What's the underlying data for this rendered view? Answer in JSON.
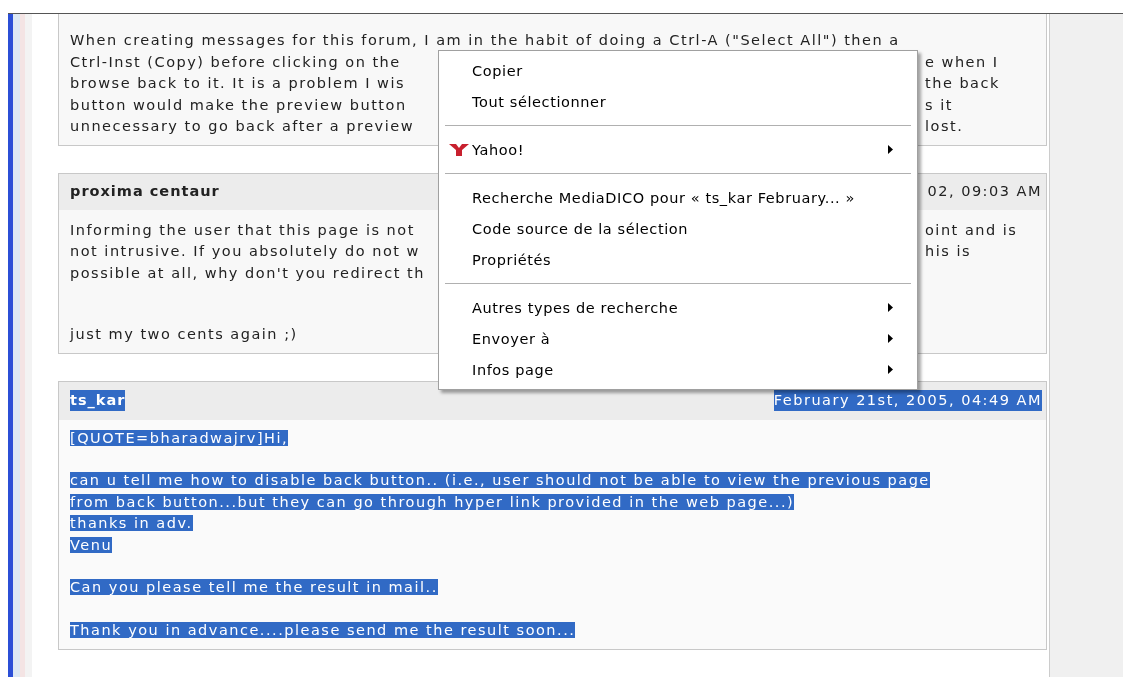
{
  "posts": [
    {
      "lines": [
        {
          "left": "When creating messages for this forum, I am in the habit of doing a Ctrl-A (\"Select All\") then a"
        },
        {
          "left": "Ctrl-Inst (Copy) before clicking on the",
          "right": "e when I"
        },
        {
          "left": "browse back to it. It is a problem I wis",
          "right": "the back"
        },
        {
          "left": "button would make the preview button",
          "right": "s it"
        },
        {
          "left": "unnecessary to go back after a preview",
          "right": "lost."
        }
      ]
    },
    {
      "author": "proxima centaur",
      "date": "02, 09:03 AM",
      "lines": [
        {
          "left": "Informing the user that this page is not",
          "right": "oint and is"
        },
        {
          "left": "not intrusive. If you absolutely do not w",
          "right": "his is"
        },
        {
          "left": "possible at all, why don't you redirect th"
        }
      ],
      "tail": "just my two cents again ;)"
    }
  ],
  "selected_post": {
    "author": "ts_kar",
    "date": "February 21st, 2005, 04:49 AM",
    "selected": true,
    "paragraphs": [
      [
        "[QUOTE=bharadwajrv]Hi,"
      ],
      [
        "can u tell me how to disable back button.. (i.e., user should not be able to view the previous page",
        "from back button...but they can go through hyper link provided in the web page...)",
        "thanks in adv.",
        "Venu"
      ],
      [
        "Can you please tell me the result in mail.."
      ],
      [
        "Thank you in advance....please send me the result soon..."
      ]
    ]
  },
  "context_menu": {
    "items": [
      {
        "kind": "item",
        "label": "Copier",
        "submenu": false
      },
      {
        "kind": "item",
        "label": "Tout sélectionner",
        "submenu": false
      },
      {
        "kind": "separator"
      },
      {
        "kind": "logo-item",
        "label": "Yahoo!",
        "submenu": true
      },
      {
        "kind": "separator"
      },
      {
        "kind": "item",
        "label": "Recherche MediaDICO pour « ts_kar February... »",
        "submenu": false
      },
      {
        "kind": "item",
        "label": "Code source de la sélection",
        "submenu": false
      },
      {
        "kind": "item",
        "label": "Propriétés",
        "submenu": false
      },
      {
        "kind": "separator"
      },
      {
        "kind": "item",
        "label": "Autres types de recherche",
        "submenu": true
      },
      {
        "kind": "item",
        "label": "Envoyer à",
        "submenu": true
      },
      {
        "kind": "item",
        "label": "Infos page",
        "submenu": true
      }
    ]
  }
}
